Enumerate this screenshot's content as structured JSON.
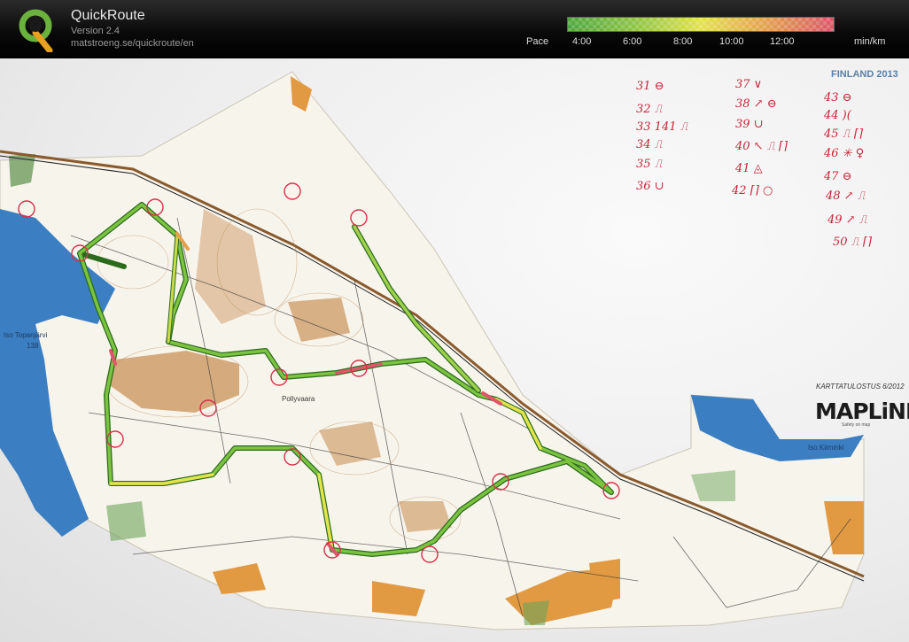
{
  "app": {
    "title": "QuickRoute",
    "version": "Version 2.4",
    "url": "matstroeng.se/quickroute/en"
  },
  "pace_scale": {
    "label": "Pace",
    "ticks": [
      "4:00",
      "6:00",
      "8:00",
      "10:00",
      "12:00"
    ],
    "unit": "min/km",
    "colors": [
      "#4ea83d",
      "#8ec63f",
      "#e3e34a",
      "#e6a04a",
      "#e0556b"
    ]
  },
  "map": {
    "country_label": "FINLAND 2013",
    "print_label": "KARTTATULOSTUS 6/2012",
    "brand": "MAPLiNE",
    "brand_tagline": "Safety on map",
    "places": {
      "lake": "Iso Topanjärvi",
      "lake_elev": "138",
      "hill": "Pollyvaara",
      "river": "Iso Kiiminki"
    },
    "control_notes": {
      "col1": [
        "31 ⊖",
        "32 ⎍",
        "33 141 ⎍",
        "34 ⎍",
        "35 ⎍",
        "36 ∪"
      ],
      "col2": [
        "37 ∨",
        "38 ↗ ⊖",
        "39 ∪",
        "40 ↖ ⎍ ⌈⌉",
        "41 ◬",
        "42 ⌈⌉ ○"
      ],
      "col3": [
        "43 ⊖",
        "44 )(",
        "45 ⎍ ⌈⌉",
        "46 ✳ ♀",
        "47 ⊖",
        "48 ↗ ⎍",
        "49 ↗ ⎍",
        "50 ⎍ ⌈⌉"
      ]
    },
    "route_colors": {
      "fast": "#4ea83d",
      "medium": "#e3e34a",
      "slow": "#e0556b",
      "control_circle": "#d8304a"
    }
  }
}
